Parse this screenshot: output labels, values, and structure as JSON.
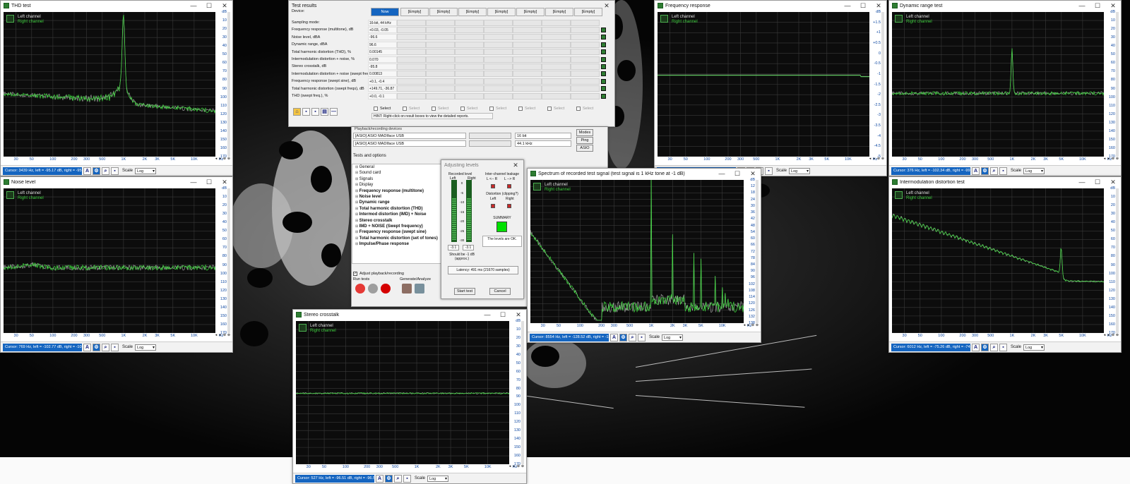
{
  "windows": {
    "thd": {
      "title": "THD test"
    },
    "noise": {
      "title": "Noise level"
    },
    "freq": {
      "title": "Frequency response"
    },
    "dyn": {
      "title": "Dynamic range test"
    },
    "imd": {
      "title": "Intermodulation distortion test"
    },
    "spectrum": {
      "title": "Spectrum of recorded test signal (test signal is 1 kHz tone at -1 dB)"
    },
    "crosstalk": {
      "title": "Stereo crosstalk"
    },
    "results": {
      "title": "Test results"
    },
    "levels": {
      "title": "Adjusting levels"
    }
  },
  "legend": {
    "left": "Left channel",
    "right": "Right channel"
  },
  "cursors": {
    "thd": "Cursor: 3439 Hz, left = -95.17 dB, right = -95.58 dB",
    "noise": "Cursor: 769 Hz, left = -102.77 dB, right = -103.40 dB",
    "freq": "Cursor: 4904 Hz, left = 0.02 dB, right = 0.02 dB",
    "dyn": "Cursor: 376 Hz, left = -102.34 dB, right = -99.84 dB",
    "imd": "Cursor: 6012 Hz, left = -75.26 dB, right = -74.52 dB",
    "spectrum": "Cursor: 8554 Hz, left = -128.52 dB, right = -130.35 dB",
    "crosstalk": "Cursor: 527 Hz, left = -96.51 dB, right = -96.52 dB"
  },
  "scale": {
    "label": "Scale",
    "value": "Log"
  },
  "x_ticks": [
    "30",
    "50",
    "100",
    "200",
    "300",
    "500",
    "1K",
    "2K",
    "3K",
    "5K",
    "10K",
    "Hz"
  ],
  "y_ticks": {
    "thd": [
      "dB",
      "10",
      "20",
      "30",
      "40",
      "50",
      "60",
      "70",
      "80",
      "90",
      "100",
      "110",
      "120",
      "130",
      "140",
      "150",
      "160",
      "170"
    ],
    "noise": [
      "dB",
      "10",
      "20",
      "30",
      "40",
      "50",
      "60",
      "70",
      "80",
      "90",
      "100",
      "110",
      "120",
      "130",
      "140",
      "150",
      "160",
      "170"
    ],
    "crosstalk": [
      "dB",
      "10",
      "20",
      "30",
      "40",
      "50",
      "60",
      "70",
      "80",
      "90",
      "100",
      "110",
      "120",
      "130",
      "140",
      "150",
      "160",
      "170"
    ],
    "dyn": [
      "dB",
      "10",
      "20",
      "30",
      "40",
      "50",
      "60",
      "70",
      "80",
      "90",
      "100",
      "110",
      "120",
      "130",
      "140",
      "150",
      "160",
      "170"
    ],
    "imd": [
      "dB",
      "10",
      "20",
      "30",
      "40",
      "50",
      "60",
      "70",
      "80",
      "90",
      "100",
      "110",
      "120",
      "130",
      "140",
      "150",
      "160",
      "170"
    ],
    "freq": [
      "dB",
      "+1.5",
      "+1",
      "+0.5",
      "0",
      "-0.5",
      "-1",
      "-1.5",
      "-2",
      "-2.5",
      "-3",
      "-3.5",
      "-4",
      "-4.5",
      "-5"
    ],
    "spectrum": [
      "dB",
      "12",
      "18",
      "24",
      "30",
      "36",
      "42",
      "48",
      "54",
      "60",
      "66",
      "72",
      "78",
      "84",
      "90",
      "96",
      "102",
      "108",
      "114",
      "120",
      "126",
      "132",
      "138"
    ]
  },
  "results": {
    "device_label": "Device:",
    "columns": [
      "[Empty]",
      "[Empty]",
      "[Empty]",
      "[Empty]",
      "[Empty]",
      "[Empty]",
      "[Empty]"
    ],
    "active_column": "Now",
    "rows": [
      {
        "label": "Sampling mode:",
        "value": "16-bit, 44 kHz"
      },
      {
        "label": "Frequency response (multitone), dB",
        "value": "+0.03, -0.05"
      },
      {
        "label": "Noise level, dBA",
        "value": "-96.6"
      },
      {
        "label": "Dynamic range, dBA",
        "value": "96.6"
      },
      {
        "label": "Total harmonic distortion (THD), %",
        "value": "0.00145"
      },
      {
        "label": "Intermodulation distortion + noise, %",
        "value": "0.070"
      },
      {
        "label": "Stereo crosstalk, dB",
        "value": "-95.8"
      },
      {
        "label": "Intermodulation distortion + noise (swept freqs), %",
        "value": "0.00813"
      },
      {
        "label": "Frequency response (swept sine), dB",
        "value": "+0.1, -0.4"
      },
      {
        "label": "Total harmonic distortion (swept freqs), dB",
        "value": "+149.71, -36.87"
      },
      {
        "label": "THD (swept freq.), %",
        "value": "+0.0, -0.1"
      }
    ],
    "select_label": "Select",
    "hint": "HINT: Right-click on result boxes to view the detailed reports."
  },
  "main": {
    "playback_header": "Playback/recording devices",
    "device1": "[ASIO] ASIO MADIface USB",
    "device2": "[ASIO] ASIO MADIface USB",
    "bits": "16 bit",
    "rate": "44.1 kHz",
    "modes_btn": "Modes",
    "ping_btn": "Ping",
    "asio_btn": "ASIO",
    "tests_header": "Tests and options",
    "tree": [
      {
        "label": "General",
        "bold": false
      },
      {
        "label": "Sound card",
        "bold": false
      },
      {
        "label": "Signals",
        "bold": false
      },
      {
        "label": "Display",
        "bold": false
      },
      {
        "label": "Frequency response (multitone)",
        "bold": true
      },
      {
        "label": "Noise level",
        "bold": true
      },
      {
        "label": "Dynamic range",
        "bold": true
      },
      {
        "label": "Total harmonic distortion (THD)",
        "bold": true
      },
      {
        "label": "Intermod distortion (IMD) + Noise",
        "bold": true
      },
      {
        "label": "Stereo crosstalk",
        "bold": true
      },
      {
        "label": "IMD + NOISE (Swept frequency)",
        "bold": true
      },
      {
        "label": "Frequency response (swept sine)",
        "bold": true
      },
      {
        "label": "Total harmonic distortion (set of tones)",
        "bold": true
      },
      {
        "label": "Impulse/Phase response",
        "bold": true
      }
    ],
    "adjust_label": "Adjust playback/recording",
    "run_tests": "Run tests",
    "generate": "Generate/Analyze"
  },
  "levels": {
    "recorded": "Recorded level",
    "left": "Left",
    "right": "Right",
    "interchannel": "Inter-channel leakage",
    "l2r": "L <-- R",
    "r2l": "L --> R",
    "distortion": "Distortion (clipping?)",
    "summary": "SUMMARY",
    "ok": "The levels are OK.",
    "meter_ticks": [
      "0",
      "-5",
      "-10",
      "-15",
      "-20",
      "-25",
      "-30"
    ],
    "left_val": "-3.1",
    "right_val": "-3.1",
    "should_be": "Should be -1 dB (approx.)",
    "latency": "Latency: 491 ms (21670 samples)",
    "start": "Start test",
    "cancel": "Cancel"
  }
}
